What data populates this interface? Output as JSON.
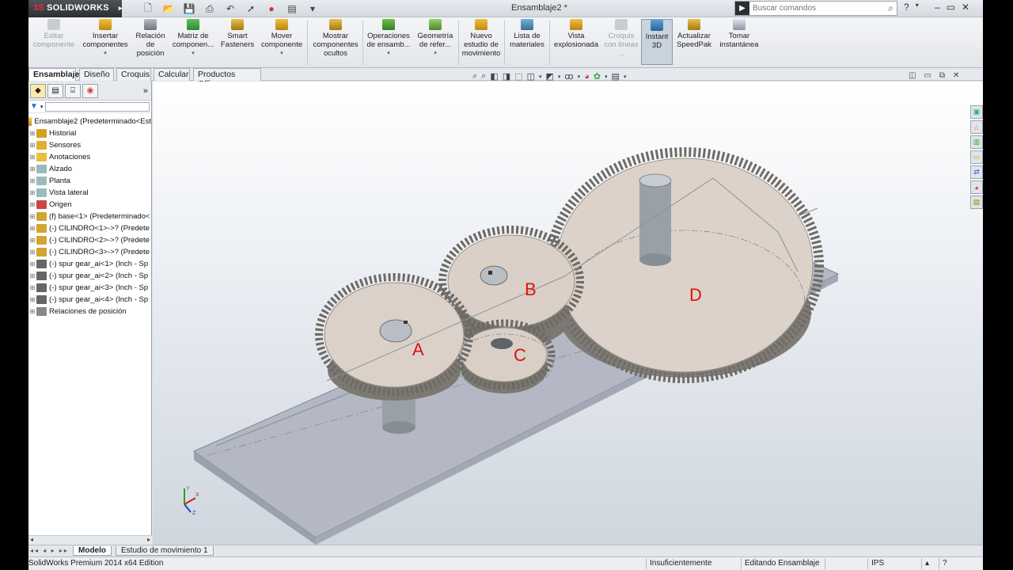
{
  "titlebar": {
    "logo_ds": "3S",
    "logo_text": "SOLIDWORKS",
    "document_title": "Ensamblaje2 *",
    "search_placeholder": "Buscar comandos"
  },
  "ribbon": {
    "buttons": [
      {
        "label": "Editar componente",
        "disabled": true
      },
      {
        "label": "Insertar componentes"
      },
      {
        "label": "Relación de posición"
      },
      {
        "label": "Matriz de componen..."
      },
      {
        "label": "Smart Fasteners"
      },
      {
        "label": "Mover componente"
      },
      {
        "label": "Mostrar componentes ocultos"
      },
      {
        "label": "Operaciones de ensamb..."
      },
      {
        "label": "Geometría de refer..."
      },
      {
        "label": "Nuevo estudio de movimiento"
      },
      {
        "label": "Lista de materiales"
      },
      {
        "label": "Vista explosionada"
      },
      {
        "label": "Croquis con líneas ...",
        "disabled": true
      },
      {
        "label": "Instant 3D",
        "pressed": true
      },
      {
        "label": "Actualizar SpeedPak"
      },
      {
        "label": "Tomar instantánea"
      }
    ]
  },
  "tabs": [
    "Ensamblaje",
    "Diseño",
    "Croquis",
    "Calcular",
    "Productos Office"
  ],
  "tree": {
    "root": "Ensamblaje2  (Predeterminado<Est",
    "items": [
      {
        "label": "Historial",
        "icon": "history-icon",
        "color": "#d8a020"
      },
      {
        "label": "Sensores",
        "icon": "sensor-icon",
        "color": "#e0b030"
      },
      {
        "label": "Anotaciones",
        "icon": "annotation-icon",
        "color": "#e8c040"
      },
      {
        "label": "Alzado",
        "icon": "plane-icon",
        "color": "#9bb"
      },
      {
        "label": "Planta",
        "icon": "plane-icon",
        "color": "#9bb"
      },
      {
        "label": "Vista lateral",
        "icon": "plane-icon",
        "color": "#9bb"
      },
      {
        "label": "Origen",
        "icon": "origin-icon",
        "color": "#c44"
      },
      {
        "label": "(f) base<1> (Predeterminado<",
        "icon": "part-icon",
        "color": "#d0a530"
      },
      {
        "label": "(-) CILINDRO<1>->? (Predete",
        "icon": "part-icon",
        "color": "#d0a530"
      },
      {
        "label": "(-) CILINDRO<2>->? (Predete",
        "icon": "part-icon",
        "color": "#d0a530"
      },
      {
        "label": "(-) CILINDRO<3>->? (Predete",
        "icon": "part-icon",
        "color": "#d0a530"
      },
      {
        "label": "(-) spur gear_ai<1> (Inch - Sp",
        "icon": "gear-part-icon",
        "color": "#666"
      },
      {
        "label": "(-) spur gear_ai<2> (Inch - Sp",
        "icon": "gear-part-icon",
        "color": "#666"
      },
      {
        "label": "(-) spur gear_ai<3> (Inch - Sp",
        "icon": "gear-part-icon",
        "color": "#666"
      },
      {
        "label": "(-) spur gear_ai<4> (Inch - Sp",
        "icon": "gear-part-icon",
        "color": "#666"
      },
      {
        "label": "Relaciones de posición",
        "icon": "mates-icon",
        "color": "#888"
      }
    ]
  },
  "viewport": {
    "gear_labels": {
      "a": "A",
      "b": "B",
      "c": "C",
      "d": "D"
    },
    "triad": {
      "y": "Y",
      "x": "X",
      "z": "Z"
    }
  },
  "bottom_tabs": [
    "Modelo",
    "Estudio de movimiento 1"
  ],
  "status": {
    "edition": "SolidWorks Premium 2014 x64 Edition",
    "definition": "Insuficientemente definida",
    "mode": "Editando Ensamblaje",
    "units": "IPS"
  },
  "colors": {
    "gear_face": "#d9cfc6",
    "gear_teeth": "#8a8680",
    "label": "#e01010",
    "base_plate": "#b9bec8"
  }
}
